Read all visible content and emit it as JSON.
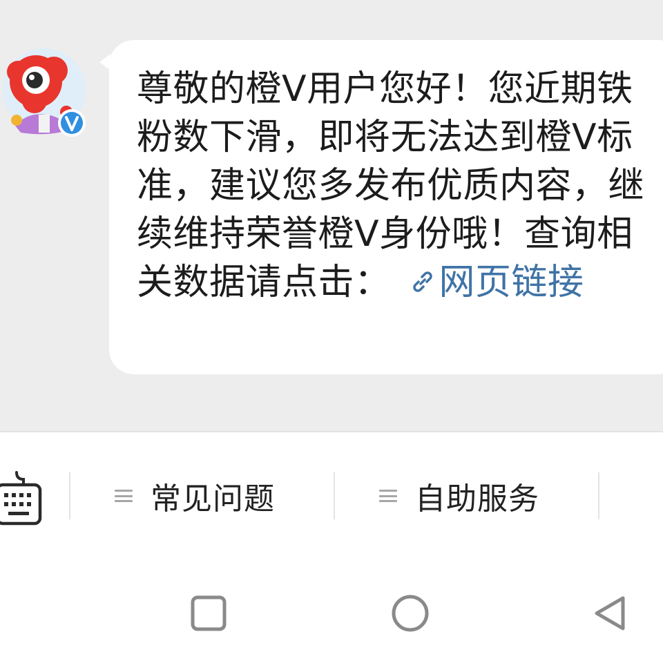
{
  "message": {
    "text": "尊敬的橙V用户您好！您近期铁粉数下滑，即将无法达到橙V标准，建议您多发布优质内容，继续维持荣誉橙V身份哦！查询相关数据请点击：",
    "link_label": "网页链接",
    "link_icon": "link-icon",
    "sender_avatar": "cartoon-mascot-avatar",
    "verified_badge": "V",
    "bubble_color": "#ffffff",
    "background_color": "#ededed",
    "link_color": "#3f73a6"
  },
  "toolbar": {
    "keyboard_icon": "keyboard-icon",
    "menu_items": [
      {
        "label": "常见问题",
        "icon": "menu-lines-icon"
      },
      {
        "label": "自助服务",
        "icon": "menu-lines-icon"
      }
    ]
  },
  "navbar": {
    "recents_icon": "square-icon",
    "home_icon": "circle-icon",
    "back_icon": "triangle-back-icon"
  }
}
